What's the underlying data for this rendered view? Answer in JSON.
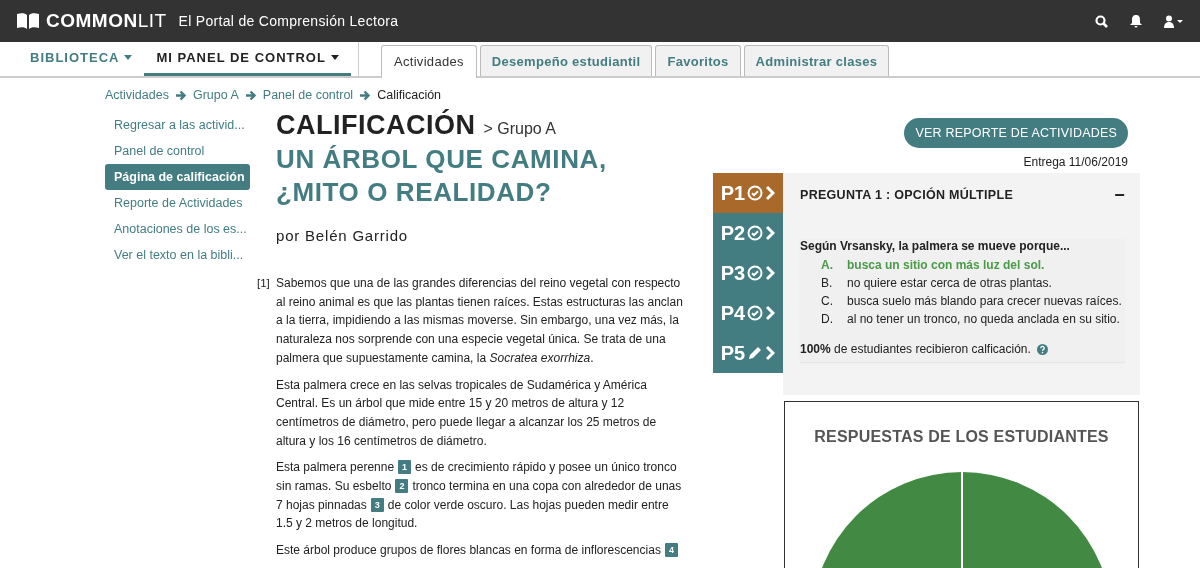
{
  "header": {
    "brand_bold": "COMMON",
    "brand_light": "LIT",
    "tagline": "El Portal de Comprensión Lectora"
  },
  "main_nav": [
    {
      "label": "BIBLIOTECA",
      "selected": false
    },
    {
      "label": "MI PANEL DE CONTROL",
      "selected": true
    }
  ],
  "tabs": [
    {
      "label": "Actividades",
      "selected": true
    },
    {
      "label": "Desempeño estudiantil",
      "selected": false
    },
    {
      "label": "Favoritos",
      "selected": false
    },
    {
      "label": "Administrar clases",
      "selected": false
    }
  ],
  "breadcrumb": [
    {
      "label": "Actividades",
      "current": false
    },
    {
      "label": "Grupo A",
      "current": false
    },
    {
      "label": "Panel de control",
      "current": false
    },
    {
      "label": "Calificación",
      "current": true
    }
  ],
  "sidebar": {
    "items": [
      {
        "label": "Regresar a las activid...",
        "selected": false
      },
      {
        "label": "Panel de control",
        "selected": false
      },
      {
        "label": "Página de calificación",
        "selected": true
      },
      {
        "label": "Reporte de Actividades",
        "selected": false
      },
      {
        "label": "Anotaciones de los es...",
        "selected": false
      },
      {
        "label": "Ver el texto en la bibli...",
        "selected": false
      }
    ]
  },
  "page": {
    "title": "CALIFICACIÓN",
    "subtitle": "> Grupo A",
    "text_title": "UN ÁRBOL QUE CAMINA, ¿MITO O REALIDAD?",
    "author": "por Belén Garrido"
  },
  "text": {
    "paragraph_number": "[1]",
    "paragraphs": [
      [
        {
          "text": "Sabemos que una de las grandes diferencias del reino vegetal con respecto al reino animal es que las plantas tienen raíces. Estas estructuras las anclan a la tierra, impidiendo a las mismas moverse. Sin embargo, una vez más, la naturaleza nos sorprende con una especie vegetal única. Se trata de una palmera que supuestamente camina, la *Socratea exorrhiza*."
        }
      ],
      [
        {
          "text": "Esta palmera crece en las selvas tropicales de Sudamérica y América Central. Es un árbol que mide entre 15 y 20 metros de altura y 12 centímetros de diámetro, pero puede llegar a alcanzar los 25 metros de altura y los 16 centímetros de diámetro."
        }
      ],
      [
        {
          "text": "Esta palmera perenne",
          "note": "1"
        },
        {
          "text": "es de crecimiento rápido y posee un único tronco sin ramas. Su esbelto",
          "note": "2"
        },
        {
          "text": "tronco termina en una copa con alrededor de unas 7 hojas pinnadas",
          "note": "3"
        },
        {
          "text": "de color verde oscuro. Las hojas pueden medir entre 1.5 y 2 metros de longitud."
        }
      ],
      [
        {
          "text": "Este árbol produce grupos de flores blancas en forma de inflorescencias",
          "note": "4"
        }
      ]
    ]
  },
  "report_button": "VER REPORTE DE ACTIVIDADES",
  "due_date": "Entrega 11/06/2019",
  "question_nav": [
    {
      "label": "P1",
      "kind": "check",
      "selected": true
    },
    {
      "label": "P2",
      "kind": "check",
      "selected": false
    },
    {
      "label": "P3",
      "kind": "check",
      "selected": false
    },
    {
      "label": "P4",
      "kind": "check",
      "selected": false
    },
    {
      "label": "P5",
      "kind": "pencil",
      "selected": false
    }
  ],
  "question": {
    "heading": "PREGUNTA 1 : OPCIÓN MÚLTIPLE",
    "collapse": "−",
    "prompt": "Según Vrsansky, la palmera se mueve porque...",
    "options": [
      {
        "letter": "A.",
        "text": "busca un sitio con más luz del sol.",
        "correct": true
      },
      {
        "letter": "B.",
        "text": "no quiere estar cerca de otras plantas.",
        "correct": false
      },
      {
        "letter": "C.",
        "text": "busca suelo más blando para crecer nuevas raíces.",
        "correct": false
      },
      {
        "letter": "D.",
        "text": "al no tener un tronco, no queda anclada en su sitio.",
        "correct": false
      }
    ],
    "graded": "**100%** de estudiantes recibieron calficación."
  },
  "responses": {
    "title": "RESPUESTAS DE LOS ESTUDIANTES"
  }
}
